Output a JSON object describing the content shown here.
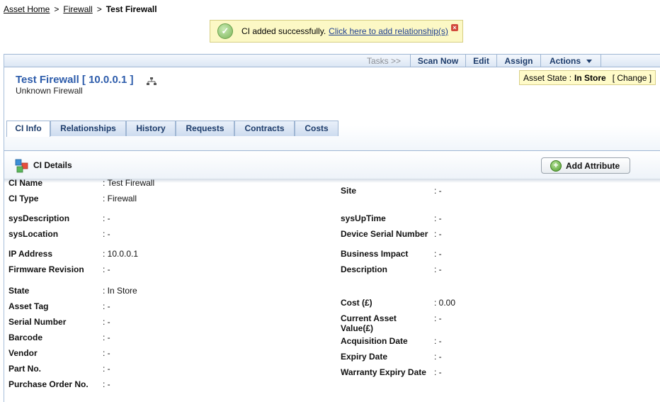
{
  "breadcrumb": {
    "home": "Asset Home",
    "sep": ">",
    "category": "Firewall",
    "current": "Test Firewall"
  },
  "notice": {
    "message": "CI added successfully.",
    "link": "Click here to add relationship(s)"
  },
  "toolbar": {
    "tasks": "Tasks >>",
    "scan": "Scan Now",
    "edit": "Edit",
    "assign": "Assign",
    "actions": "Actions"
  },
  "header": {
    "title": "Test Firewall [ 10.0.0.1 ]",
    "subtitle": "Unknown Firewall",
    "asset_state_label": "Asset State  :",
    "asset_state_value": "In Store",
    "change": "[ Change ]"
  },
  "tabs": [
    "CI Info",
    "Relationships",
    "History",
    "Requests",
    "Contracts",
    "Costs"
  ],
  "details": {
    "title": "CI Details",
    "add_attribute": "Add Attribute"
  },
  "fields_left": [
    {
      "label": "CI Name",
      "value": ": Test Firewall"
    },
    {
      "label": "CI Type",
      "value": ": Firewall"
    },
    {
      "label": "sysDescription",
      "value": ": -"
    },
    {
      "label": "sysLocation",
      "value": ": -"
    },
    {
      "label": "IP Address",
      "value": ": 10.0.0.1"
    },
    {
      "label": "Firmware Revision",
      "value": ": -"
    },
    {
      "label": "State",
      "value": ": In Store"
    },
    {
      "label": "Asset Tag",
      "value": ": -"
    },
    {
      "label": "Serial Number",
      "value": ": -"
    },
    {
      "label": "Barcode",
      "value": ": -"
    },
    {
      "label": "Vendor",
      "value": ": -"
    },
    {
      "label": "Part No.",
      "value": ": -"
    },
    {
      "label": "Purchase Order No.",
      "value": ": -"
    }
  ],
  "fields_right": [
    {
      "label": "Site",
      "value": ": -"
    },
    {
      "label": "sysUpTime",
      "value": ": -"
    },
    {
      "label": "Device Serial Number",
      "value": ": -"
    },
    {
      "label": "Business Impact",
      "value": ": -"
    },
    {
      "label": "Description",
      "value": ": -"
    },
    {
      "label": "Cost (£)",
      "value": ": 0.00"
    },
    {
      "label": "Current Asset Value(£)",
      "value": ": -"
    },
    {
      "label": "Acquisition Date",
      "value": ": -"
    },
    {
      "label": "Expiry Date",
      "value": ": -"
    },
    {
      "label": "Warranty Expiry Date",
      "value": ": -"
    }
  ],
  "colors": {
    "accent": "#2d5cab",
    "notice_bg": "#fcf8c5",
    "asset_state_bg": "#fffbc9"
  }
}
